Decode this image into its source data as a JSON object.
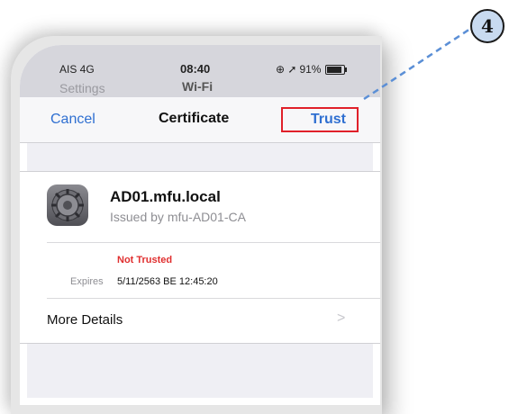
{
  "status_bar": {
    "carrier": "AIS 4G",
    "time": "08:40",
    "battery": "91%"
  },
  "underlying": {
    "back_label": "Settings",
    "title": "Wi-Fi"
  },
  "nav": {
    "cancel_label": "Cancel",
    "title": "Certificate",
    "trust_label": "Trust"
  },
  "certificate": {
    "name": "AD01.mfu.local",
    "issuer": "Issued by mfu-AD01-CA",
    "status": "Not Trusted",
    "expires_label": "Expires",
    "expires_value": "5/11/2563 BE 12:45:20",
    "more_details_label": "More Details"
  },
  "annotation": {
    "step_number": "4",
    "highlight_color": "#e0202a",
    "connector_color": "#5b8fd6"
  },
  "colors": {
    "ios_blue": "#2f6fd1",
    "not_trusted_red": "#e02f2f"
  }
}
